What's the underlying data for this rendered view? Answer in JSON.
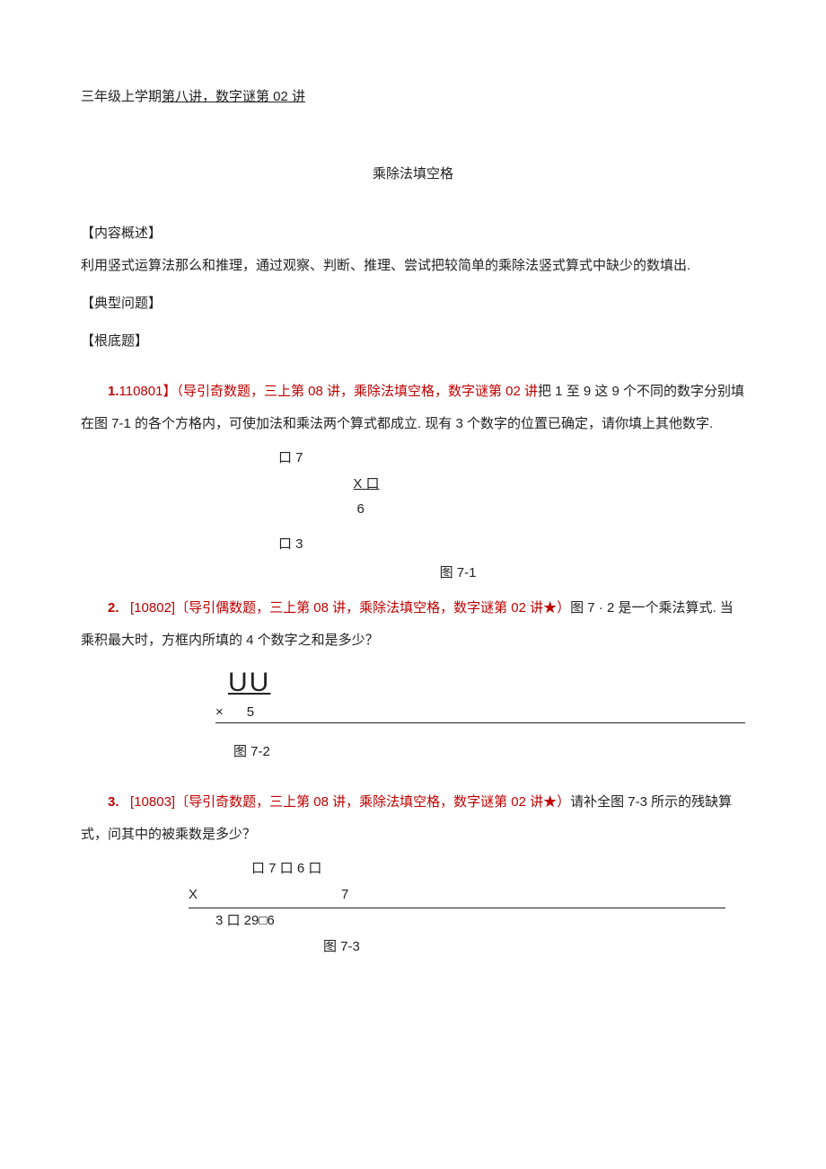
{
  "header": {
    "prefix": "三年级上学期",
    "underlined": "第八讲，数字谜第 02 讲"
  },
  "title": "乘除法填空格",
  "sections": {
    "overview_label": "【内容概述】",
    "overview_text": "利用竖式运算法那么和推理，通过观察、判断、推理、尝试把较简单的乘除法竖式算式中缺少的数填出.",
    "typical_label": "【典型问题】",
    "basic_label": "【根底题】"
  },
  "problems": [
    {
      "num": "1.",
      "code": "110801】",
      "tag": "（导引奇数题，三上第 08 讲，乘除法填空格，数字谜第 02 讲",
      "tail": "把 1 至 9 这 9 个不同的数字分别填在图 7-1 的各个方格内，可使加法和乘法两个算式都成立. 现有 3 个数字的位置已确定，请你填上其他数字.",
      "figure": {
        "line1": "口 7",
        "line2_prefix": "                    ",
        "line2_mul": "X 口",
        "line3_prefix": "                     ",
        "line3": "6",
        "line4": "口 3",
        "caption": "图 7-1"
      }
    },
    {
      "num": "2.",
      "code": "[10802]",
      "tag": "〔导引偶数题，三上第 08 讲，乘除法填空格，数字谜第 02 讲★）",
      "tail": "图 7 · 2 是一个乘法算式. 当乘积最大时，方框内所填的 4 个数字之和是多少？",
      "figure": {
        "boxes": "UU",
        "times": "×",
        "five": "5",
        "caption": "图 7-2"
      }
    },
    {
      "num": "3.",
      "code": "[10803]",
      "tag": "〔导引奇数题，三上第 08 讲，乘除法填空格，数字谜第 02 讲★）",
      "tail": "请补全图 7-3 所示的残缺算式，问其中的被乘数是多少？",
      "figure": {
        "line1": "口 7 口 6 口",
        "x": "X",
        "seven": "7",
        "result": "3 口 29□6",
        "caption": "图 7-3"
      }
    }
  ]
}
